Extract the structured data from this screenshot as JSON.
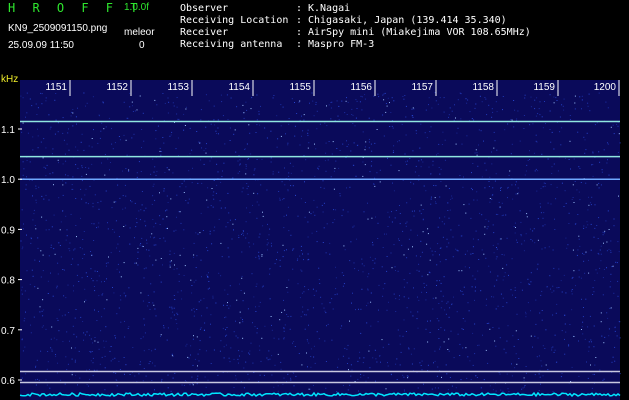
{
  "header": {
    "app_name": "H R O F F T",
    "version": "1.0.0f",
    "filename": "KN9_2509091150.png",
    "mode_label": "meleor",
    "mode_value": "0",
    "datetime": "25.09.09 11:50",
    "info": [
      {
        "label": "Observer",
        "value": "K.Nagai"
      },
      {
        "label": "Receiving Location",
        "value": "Chigasaki, Japan (139.414 35.340)"
      },
      {
        "label": "Receiver",
        "value": "AirSpy mini (Miakejima VOR 108.65MHz)"
      },
      {
        "label": "Receiving antenna",
        "value": "Maspro FM-3"
      }
    ]
  },
  "spectrogram": {
    "y_unit": "kHz",
    "y_ticks": [
      "1.1",
      "1.0",
      "0.9",
      "0.8",
      "0.7",
      "0.6"
    ],
    "x_ticks": [
      "1151",
      "1152",
      "1153",
      "1154",
      "1155",
      "1156",
      "1157",
      "1158",
      "1159",
      "1200"
    ],
    "colors": {
      "background": "#0a0a5a",
      "noise": "#2a4ad8",
      "carrier": "#7fd6ff",
      "baseline": "#00e5ff",
      "tick_text": "#ffffff",
      "unit_text": "#f0ee2a"
    },
    "horizontal_lines": [
      {
        "freq_khz": 1.115,
        "color": "#8fe6e0"
      },
      {
        "freq_khz": 1.045,
        "color": "#8fe6e0"
      },
      {
        "freq_khz": 1.0,
        "color": "#6fa8ff"
      },
      {
        "freq_khz": 0.617,
        "color": "#c8c8e0"
      },
      {
        "freq_khz": 0.595,
        "color": "#c8c8e0"
      }
    ]
  }
}
